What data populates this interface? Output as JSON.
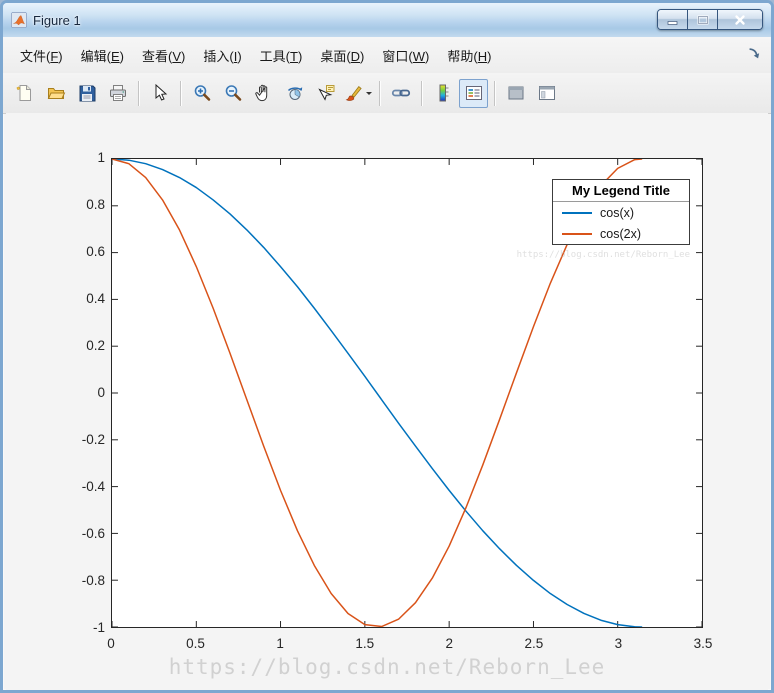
{
  "window": {
    "title": "Figure 1",
    "icon": "matlab-logo-icon",
    "controls": [
      {
        "id": "minimize-button",
        "icon": "minimize-icon"
      },
      {
        "id": "maximize-button",
        "icon": "maximize-icon"
      },
      {
        "id": "close-button",
        "icon": "close-icon"
      }
    ]
  },
  "menu": {
    "items": [
      {
        "id": "file",
        "pre": "文件(",
        "key": "F",
        "post": ")"
      },
      {
        "id": "edit",
        "pre": "编辑(",
        "key": "E",
        "post": ")"
      },
      {
        "id": "view",
        "pre": "查看(",
        "key": "V",
        "post": ")"
      },
      {
        "id": "insert",
        "pre": "插入(",
        "key": "I",
        "post": ")"
      },
      {
        "id": "tools",
        "pre": "工具(",
        "key": "T",
        "post": ")"
      },
      {
        "id": "desktop",
        "pre": "桌面(",
        "key": "D",
        "post": ")"
      },
      {
        "id": "window",
        "pre": "窗口(",
        "key": "W",
        "post": ")"
      },
      {
        "id": "help",
        "pre": "帮助(",
        "key": "H",
        "post": ")"
      }
    ],
    "dock_icon": "dock-figure-icon"
  },
  "toolbar": {
    "buttons": [
      {
        "id": "new-figure-button",
        "icon": "new-document-icon",
        "group": 1
      },
      {
        "id": "open-file-button",
        "icon": "open-folder-icon",
        "group": 1
      },
      {
        "id": "save-figure-button",
        "icon": "save-icon",
        "group": 1
      },
      {
        "id": "print-figure-button",
        "icon": "print-icon",
        "group": 1
      },
      {
        "id": "edit-plot-button",
        "icon": "cursor-arrow-icon",
        "group": 2
      },
      {
        "id": "zoom-in-button",
        "icon": "zoom-in-icon",
        "group": 3
      },
      {
        "id": "zoom-out-button",
        "icon": "zoom-out-icon",
        "group": 3
      },
      {
        "id": "pan-button",
        "icon": "pan-hand-icon",
        "group": 3
      },
      {
        "id": "rotate-3d-button",
        "icon": "rotate-3d-icon",
        "group": 3
      },
      {
        "id": "data-cursor-button",
        "icon": "data-cursor-icon",
        "group": 3
      },
      {
        "id": "brush-data-button",
        "icon": "brush-icon",
        "group": 3,
        "has_dropdown": true
      },
      {
        "id": "link-plot-button",
        "icon": "link-plot-icon",
        "group": 4
      },
      {
        "id": "insert-colorbar-button",
        "icon": "colorbar-icon",
        "group": 5
      },
      {
        "id": "insert-legend-button",
        "icon": "legend-icon",
        "group": 5,
        "pressed": true
      },
      {
        "id": "hide-plot-tools-button",
        "icon": "hide-plot-tools-icon",
        "group": 6
      },
      {
        "id": "show-plot-tools-button",
        "icon": "show-plot-tools-icon",
        "group": 6
      }
    ]
  },
  "chart_data": {
    "type": "line",
    "title": "",
    "xlabel": "",
    "ylabel": "",
    "xlim": [
      0,
      3.5
    ],
    "ylim": [
      -1,
      1
    ],
    "xticks": [
      0,
      0.5,
      1,
      1.5,
      2,
      2.5,
      3,
      3.5
    ],
    "yticks": [
      -1,
      -0.8,
      -0.6,
      -0.4,
      -0.2,
      0,
      0.2,
      0.4,
      0.6,
      0.8,
      1
    ],
    "grid": false,
    "box": true,
    "legend": {
      "title": "My Legend Title",
      "entries": [
        "cos(x)",
        "cos(2x)"
      ],
      "position": "northeast"
    },
    "x": [
      0,
      0.1,
      0.2,
      0.3,
      0.4,
      0.5,
      0.6,
      0.7,
      0.8,
      0.9,
      1.0,
      1.1,
      1.2,
      1.3,
      1.4,
      1.5,
      1.6,
      1.7,
      1.8,
      1.9,
      2.0,
      2.1,
      2.2,
      2.3,
      2.4,
      2.5,
      2.6,
      2.7,
      2.8,
      2.9,
      3.0,
      3.1,
      3.1416
    ],
    "series": [
      {
        "name": "cos(x)",
        "formula": "cos(x)",
        "color": "#0072BD",
        "values": [
          1,
          0.995,
          0.98,
          0.955,
          0.921,
          0.878,
          0.825,
          0.765,
          0.697,
          0.622,
          0.54,
          0.454,
          0.362,
          0.267,
          0.17,
          0.071,
          -0.029,
          -0.129,
          -0.227,
          -0.323,
          -0.416,
          -0.505,
          -0.589,
          -0.666,
          -0.737,
          -0.801,
          -0.857,
          -0.904,
          -0.942,
          -0.971,
          -0.99,
          -0.999,
          -1
        ]
      },
      {
        "name": "cos(2x)",
        "formula": "cos(2x)",
        "color": "#D95319",
        "values": [
          1,
          0.98,
          0.921,
          0.825,
          0.697,
          0.54,
          0.362,
          0.17,
          -0.029,
          -0.227,
          -0.416,
          -0.589,
          -0.737,
          -0.857,
          -0.942,
          -0.99,
          -0.998,
          -0.967,
          -0.896,
          -0.791,
          -0.654,
          -0.49,
          -0.307,
          -0.112,
          0.087,
          0.284,
          0.469,
          0.635,
          0.776,
          0.886,
          0.96,
          0.997,
          1
        ]
      }
    ]
  },
  "watermark": {
    "text": "https://blog.csdn.net/Reborn_Lee"
  }
}
